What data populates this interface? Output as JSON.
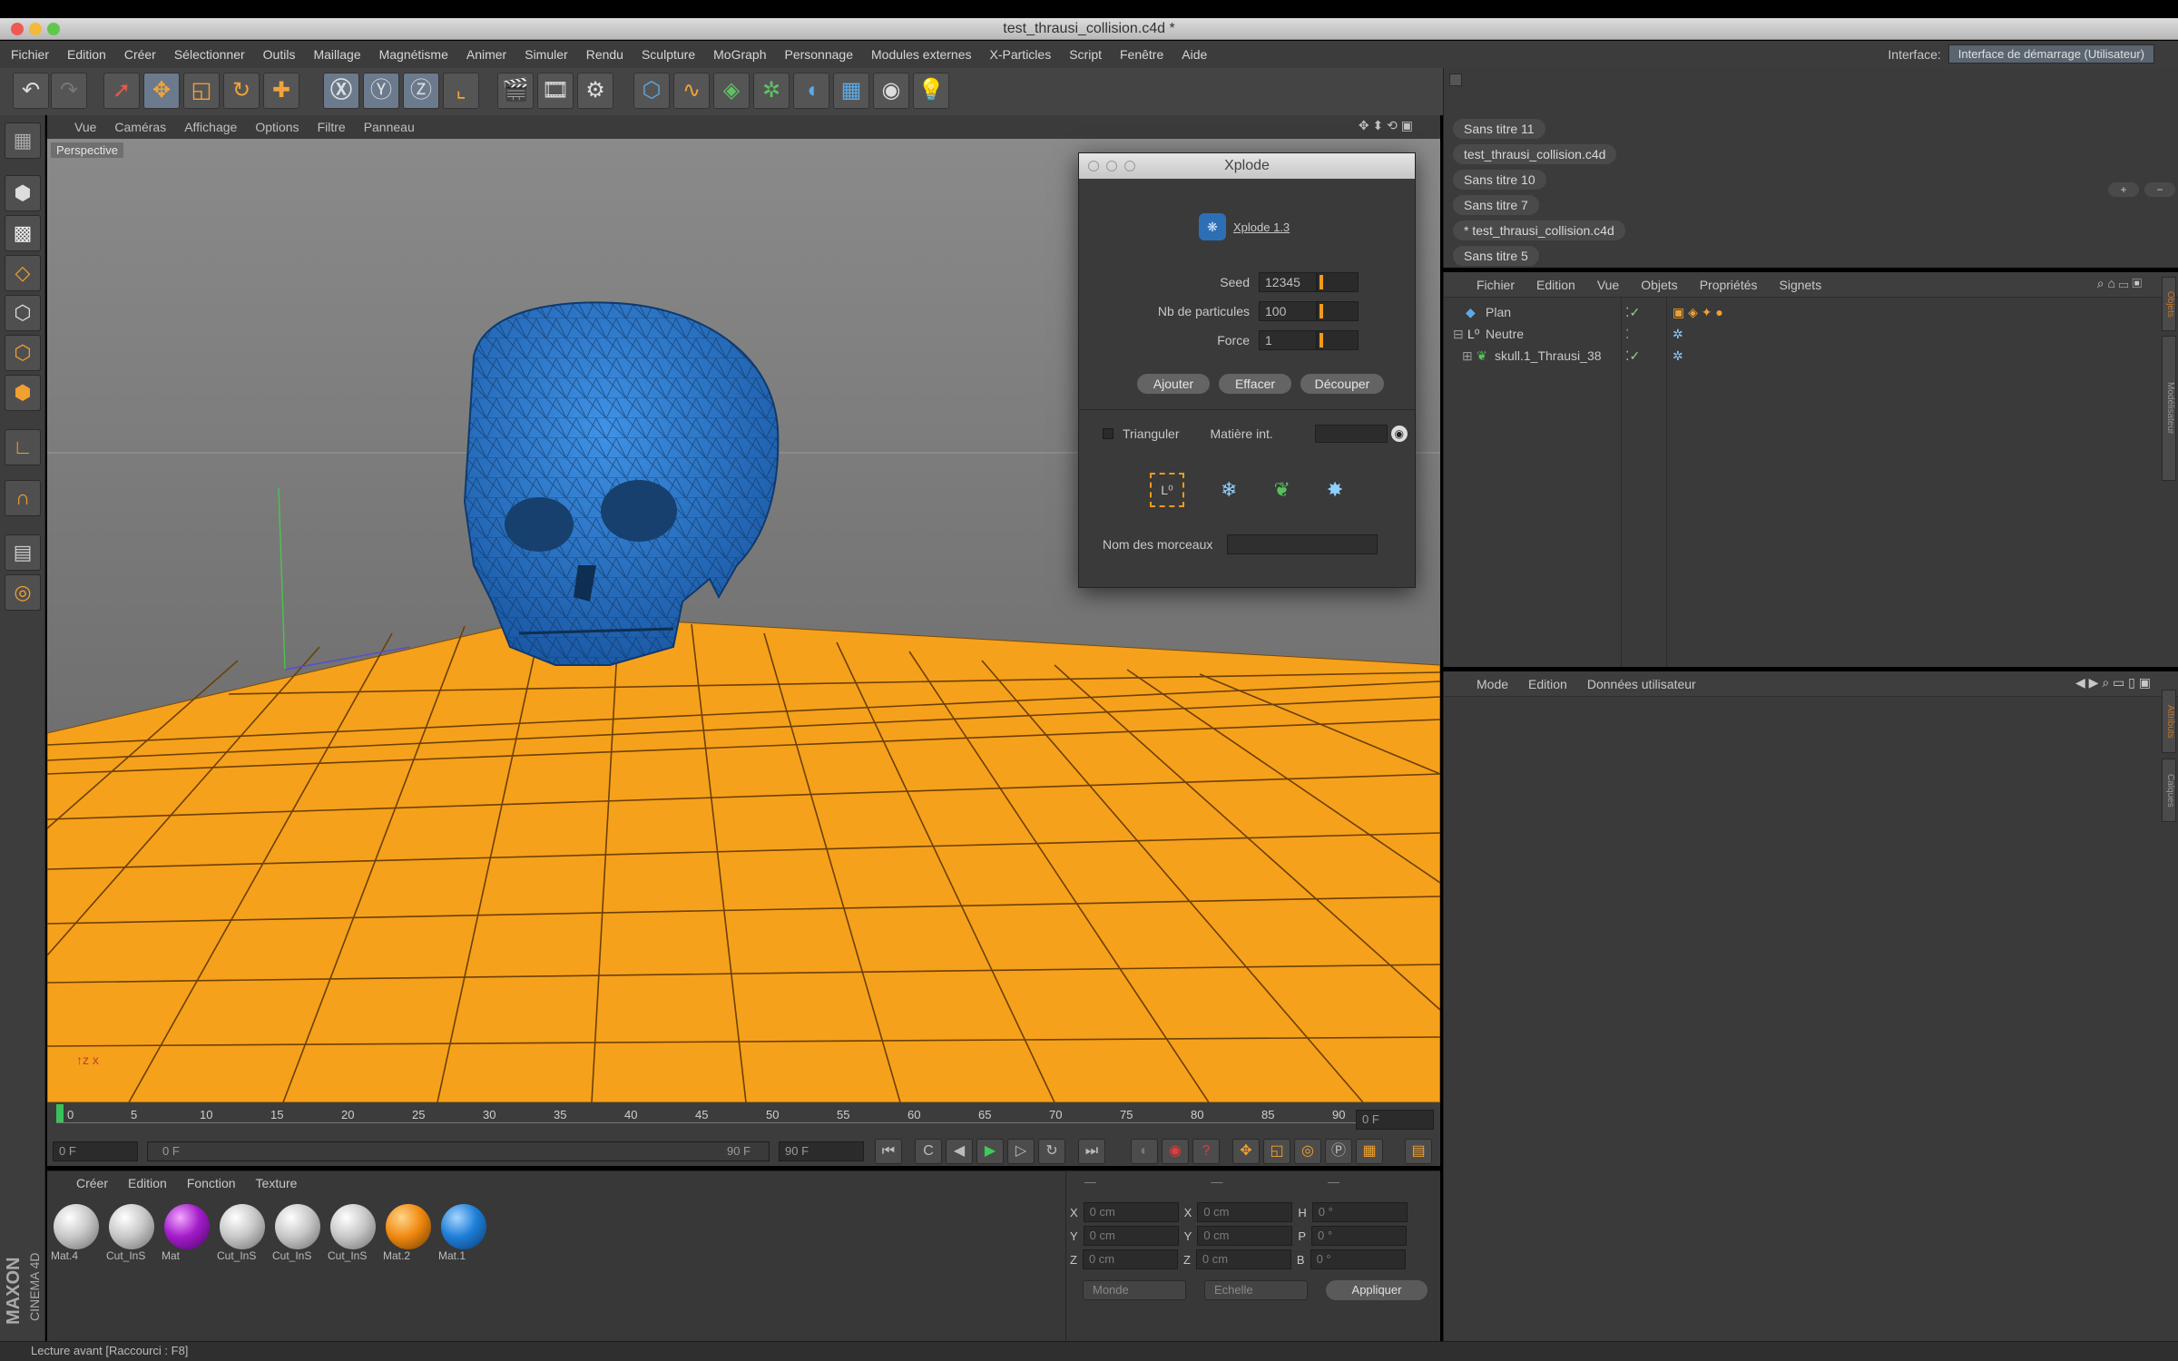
{
  "window": {
    "title": "test_thrausi_collision.c4d *"
  },
  "menubar": {
    "items": [
      "Fichier",
      "Edition",
      "Créer",
      "Sélectionner",
      "Outils",
      "Maillage",
      "Magnétisme",
      "Animer",
      "Simuler",
      "Rendu",
      "Sculpture",
      "MoGraph",
      "Personnage",
      "Modules externes",
      "X-Particles",
      "Script",
      "Fenêtre",
      "Aide"
    ],
    "interface_label": "Interface:",
    "interface_value": "Interface de démarrage (Utilisateur)"
  },
  "viewport": {
    "menu": [
      "Vue",
      "Caméras",
      "Affichage",
      "Options",
      "Filtre",
      "Panneau"
    ],
    "camera_label": "Perspective"
  },
  "xplode": {
    "title": "Xplode",
    "version": "Xplode 1.3",
    "seed_label": "Seed",
    "seed_value": "12345",
    "particles_label": "Nb de particules",
    "particles_value": "100",
    "force_label": "Force",
    "force_value": "1",
    "btn_add": "Ajouter",
    "btn_clear": "Effacer",
    "btn_cut": "Découper",
    "triangulate_label": "Trianguler",
    "matiere_label": "Matière int.",
    "pieces_label": "Nom des morceaux"
  },
  "documents": [
    "Sans titre 11",
    "test_thrausi_collision.c4d",
    "Sans titre 10",
    "Sans titre 7",
    "* test_thrausi_collision.c4d",
    "Sans titre 5"
  ],
  "object_manager": {
    "menu": [
      "Fichier",
      "Edition",
      "Vue",
      "Objets",
      "Propriétés",
      "Signets"
    ],
    "objects": [
      "Plan",
      "Neutre",
      "skull.1_Thrausi_38"
    ]
  },
  "attributes": {
    "menu": [
      "Mode",
      "Edition",
      "Données utilisateur"
    ]
  },
  "timeline": {
    "ticks": [
      "0",
      "5",
      "10",
      "15",
      "20",
      "25",
      "30",
      "35",
      "40",
      "45",
      "50",
      "55",
      "60",
      "65",
      "70",
      "75",
      "80",
      "85",
      "90"
    ],
    "current_frame": "0 F",
    "start_field": "0 F",
    "range_start": "0 F",
    "range_end": "90 F",
    "end_field": "90 F"
  },
  "materials": {
    "menu": [
      "Créer",
      "Edition",
      "Fonction",
      "Texture"
    ],
    "items": [
      {
        "name": "Mat.4",
        "color": "#c8c8c8"
      },
      {
        "name": "Cut_InS",
        "color": "#c8c8c8"
      },
      {
        "name": "Mat",
        "color": "#a21cc9"
      },
      {
        "name": "Cut_InS",
        "color": "#c8c8c8"
      },
      {
        "name": "Cut_InS",
        "color": "#c8c8c8"
      },
      {
        "name": "Cut_InS",
        "color": "#c8c8c8"
      },
      {
        "name": "Mat.2",
        "color": "#f08a10"
      },
      {
        "name": "Mat.1",
        "color": "#1f7fd8"
      }
    ]
  },
  "coordinates": {
    "rows": [
      {
        "a": "X",
        "av": "0 cm",
        "b": "X",
        "bv": "0 cm",
        "c": "H",
        "cv": "0 °"
      },
      {
        "a": "Y",
        "av": "0 cm",
        "b": "Y",
        "bv": "0 cm",
        "c": "P",
        "cv": "0 °"
      },
      {
        "a": "Z",
        "av": "0 cm",
        "b": "Z",
        "bv": "0 cm",
        "c": "B",
        "cv": "0 °"
      }
    ],
    "mode_select": "Monde",
    "scale_select": "Echelle",
    "apply": "Appliquer"
  },
  "status": "Lecture avant [Raccourci : F8]",
  "logo": {
    "brand": "MAXON",
    "product": "CINEMA 4D"
  },
  "colors": {
    "accent_orange": "#f29a18",
    "skull_blue": "#2f7fd3",
    "bg_dark": "#3a3a3a"
  }
}
